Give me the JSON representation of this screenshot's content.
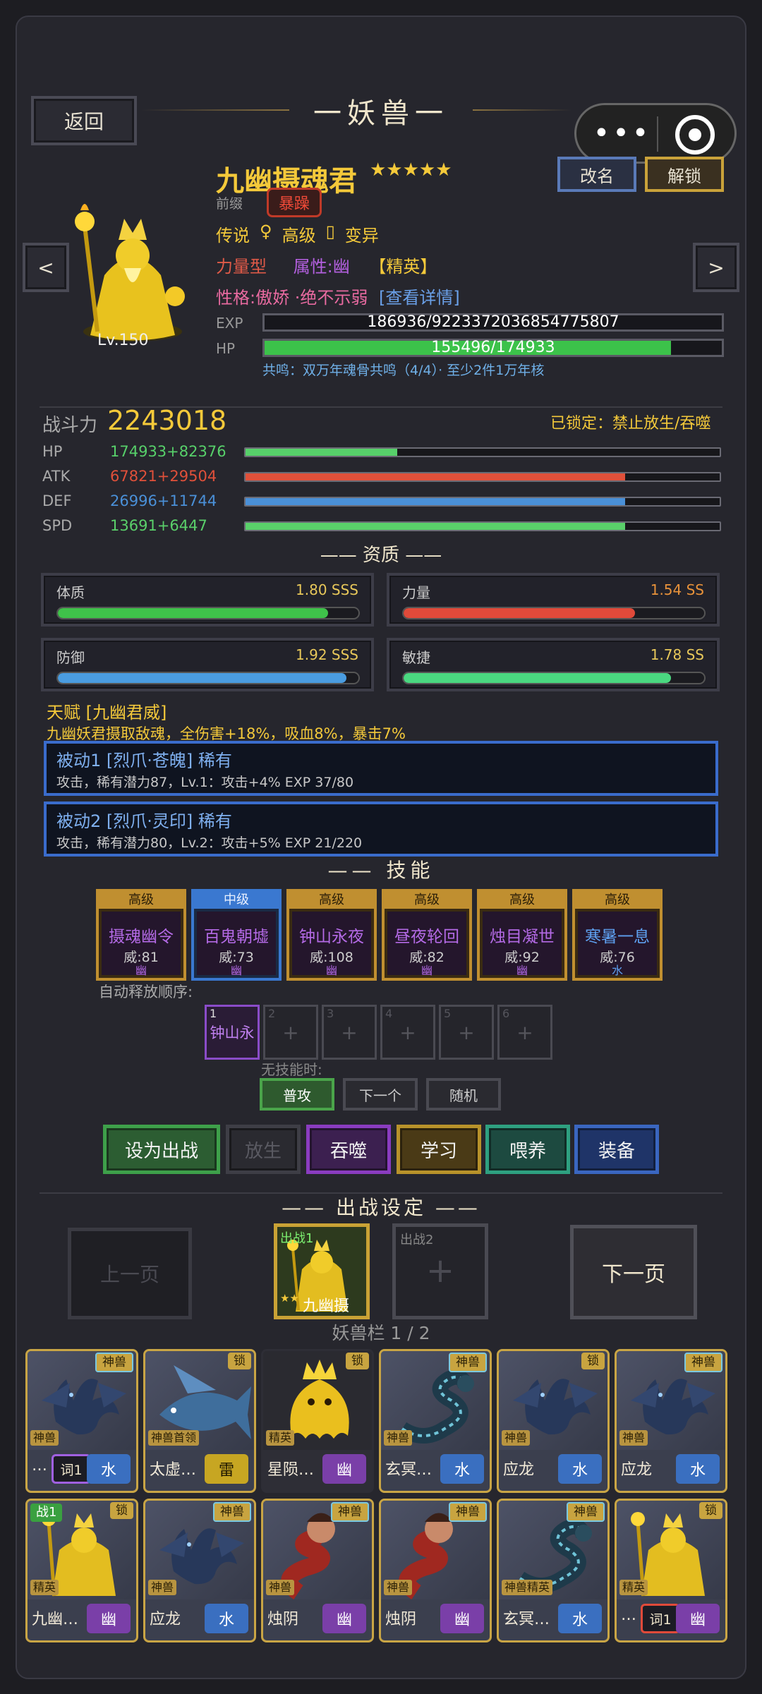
{
  "header": {
    "title": "一妖兽一",
    "back_label": "返回",
    "rename_label": "改名",
    "unlock_label": "解锁"
  },
  "monster": {
    "name": "九幽摄魂君",
    "stars": "★★★★★",
    "prefix_label": "前缀",
    "prefix_value": "暴躁",
    "level": "Lv.150",
    "line1": [
      "传说",
      "♀",
      "高级",
      "▯",
      "变异"
    ],
    "type": "力量型",
    "attribute": "属性:幽",
    "elite": "【精英】",
    "personality": "性格:傲娇 ·绝不示弱",
    "detail_link": "[查看详情]",
    "exp_label": "EXP",
    "exp_text": "186936/9223372036854775807",
    "exp_fraction": 0.0,
    "hp_label": "HP",
    "hp_text": "155496/174933",
    "hp_fraction": 0.889,
    "resonance": "共鸣：双万年魂骨共鸣（4/4）· 至少2件1万年核"
  },
  "combat": {
    "power_label": "战斗力",
    "power": "2243018",
    "lock_text": "已锁定：禁止放生/吞噬",
    "stats": [
      {
        "label": "HP",
        "value": "174933+82376",
        "color": "#57d06a",
        "fill": 0.32
      },
      {
        "label": "ATK",
        "value": "67821+29504",
        "color": "#e0503a",
        "fill": 0.8
      },
      {
        "label": "DEF",
        "value": "26996+11744",
        "color": "#4a90d8",
        "fill": 0.8
      },
      {
        "label": "SPD",
        "value": "13691+6447",
        "color": "#5ad06a",
        "fill": 0.8
      }
    ]
  },
  "aptitude": {
    "title": "资质",
    "items": [
      {
        "name": "体质",
        "value": "1.80 SSS",
        "color": "#3fc24a",
        "fill": 0.9,
        "vcolor": "#e8c85a"
      },
      {
        "name": "力量",
        "value": "1.54 SS",
        "color": "#e04a3a",
        "fill": 0.77,
        "vcolor": "#e8923a"
      },
      {
        "name": "防御",
        "value": "1.92 SSS",
        "color": "#4a9ce0",
        "fill": 0.96,
        "vcolor": "#e8c85a"
      },
      {
        "name": "敏捷",
        "value": "1.78 SS",
        "color": "#4ad880",
        "fill": 0.89,
        "vcolor": "#e8c85a"
      }
    ]
  },
  "talent": {
    "title": "天赋 [九幽君威]",
    "desc": "九幽妖君摄取敌魂，全伤害+18%，吸血8%，暴击7%"
  },
  "passives": [
    {
      "title": "被动1 [烈爪·苍魄] 稀有",
      "desc": "攻击，稀有潜力87，Lv.1：攻击+4%  EXP 37/80"
    },
    {
      "title": "被动2 [烈爪·灵印] 稀有",
      "desc": "攻击，稀有潜力80，Lv.2：攻击+5%  EXP 21/220"
    }
  ],
  "skills": {
    "title": "技能",
    "items": [
      {
        "grade": "高级",
        "name": "摄魂幽令",
        "power": "威:81",
        "elem": "幽",
        "style": "gold"
      },
      {
        "grade": "中级",
        "name": "百鬼朝墟",
        "power": "威:73",
        "elem": "幽",
        "style": "blue"
      },
      {
        "grade": "高级",
        "name": "钟山永夜",
        "power": "威:108",
        "elem": "幽",
        "style": "gold"
      },
      {
        "grade": "高级",
        "name": "昼夜轮回",
        "power": "威:82",
        "elem": "幽",
        "style": "gold"
      },
      {
        "grade": "高级",
        "name": "烛目凝世",
        "power": "威:92",
        "elem": "幽",
        "style": "gold"
      },
      {
        "grade": "高级",
        "name": "寒暑一息",
        "power": "威:76",
        "elem": "水",
        "style": "gold"
      }
    ],
    "auto_label": "自动释放顺序:",
    "slots": [
      {
        "n": "1",
        "text": "钟山永"
      },
      {
        "n": "2",
        "text": "+"
      },
      {
        "n": "3",
        "text": "+"
      },
      {
        "n": "4",
        "text": "+"
      },
      {
        "n": "5",
        "text": "+"
      },
      {
        "n": "6",
        "text": "+"
      }
    ],
    "no_skill_label": "无技能时:",
    "modes": [
      "普攻",
      "下一个",
      "随机"
    ]
  },
  "actions": [
    "设为出战",
    "放生",
    "吞噬",
    "学习",
    "喂养",
    "装备"
  ],
  "battle": {
    "title": "出战设定",
    "prev": "上一页",
    "next": "下一页",
    "slot1_tag": "出战1",
    "slot1_name": "九幽摄",
    "slot1_stars": "★★",
    "slot2_tag": "出战2",
    "slot2_plus": "+"
  },
  "bag": {
    "title": "妖兽栏 1 / 2",
    "cards": [
      {
        "tag": "神兽",
        "rar": "神兽",
        "name": "…",
        "extra": "词1",
        "elem": "水",
        "eclass": "water",
        "art": "dragon"
      },
      {
        "tag": "锁",
        "rar": "神兽首领",
        "name": "太虚…",
        "elem": "雷",
        "eclass": "thunder",
        "art": "fish"
      },
      {
        "tag": "锁",
        "rar": "精英",
        "name": "星陨…",
        "elem": "幽",
        "eclass": "dark",
        "art": "ghost"
      },
      {
        "tag": "神兽",
        "rar": "神兽",
        "name": "玄冥…",
        "elem": "水",
        "eclass": "water",
        "art": "serpent"
      },
      {
        "tag": "锁",
        "rar": "神兽",
        "name": "应龙",
        "elem": "水",
        "eclass": "water",
        "art": "dragon"
      },
      {
        "tag": "神兽",
        "rar": "神兽",
        "name": "应龙",
        "elem": "水",
        "eclass": "water",
        "art": "dragon"
      },
      {
        "tag": "锁",
        "rar": "精英",
        "name": "九幽…",
        "elem": "幽",
        "eclass": "dark",
        "art": "king",
        "badge": "战1"
      },
      {
        "tag": "神兽",
        "rar": "神兽",
        "name": "应龙",
        "elem": "水",
        "eclass": "water",
        "art": "dragon"
      },
      {
        "tag": "神兽",
        "rar": "神兽",
        "name": "烛阴",
        "elem": "幽",
        "eclass": "dark",
        "art": "snake"
      },
      {
        "tag": "神兽",
        "rar": "神兽",
        "name": "烛阴",
        "elem": "幽",
        "eclass": "dark",
        "art": "snake"
      },
      {
        "tag": "神兽",
        "rar": "神兽精英",
        "name": "玄冥…",
        "elem": "水",
        "eclass": "water",
        "art": "serpent"
      },
      {
        "tag": "锁",
        "rar": "精英",
        "name": "…",
        "extra": "词1",
        "elem": "幽",
        "eclass": "dark",
        "art": "king"
      }
    ]
  }
}
